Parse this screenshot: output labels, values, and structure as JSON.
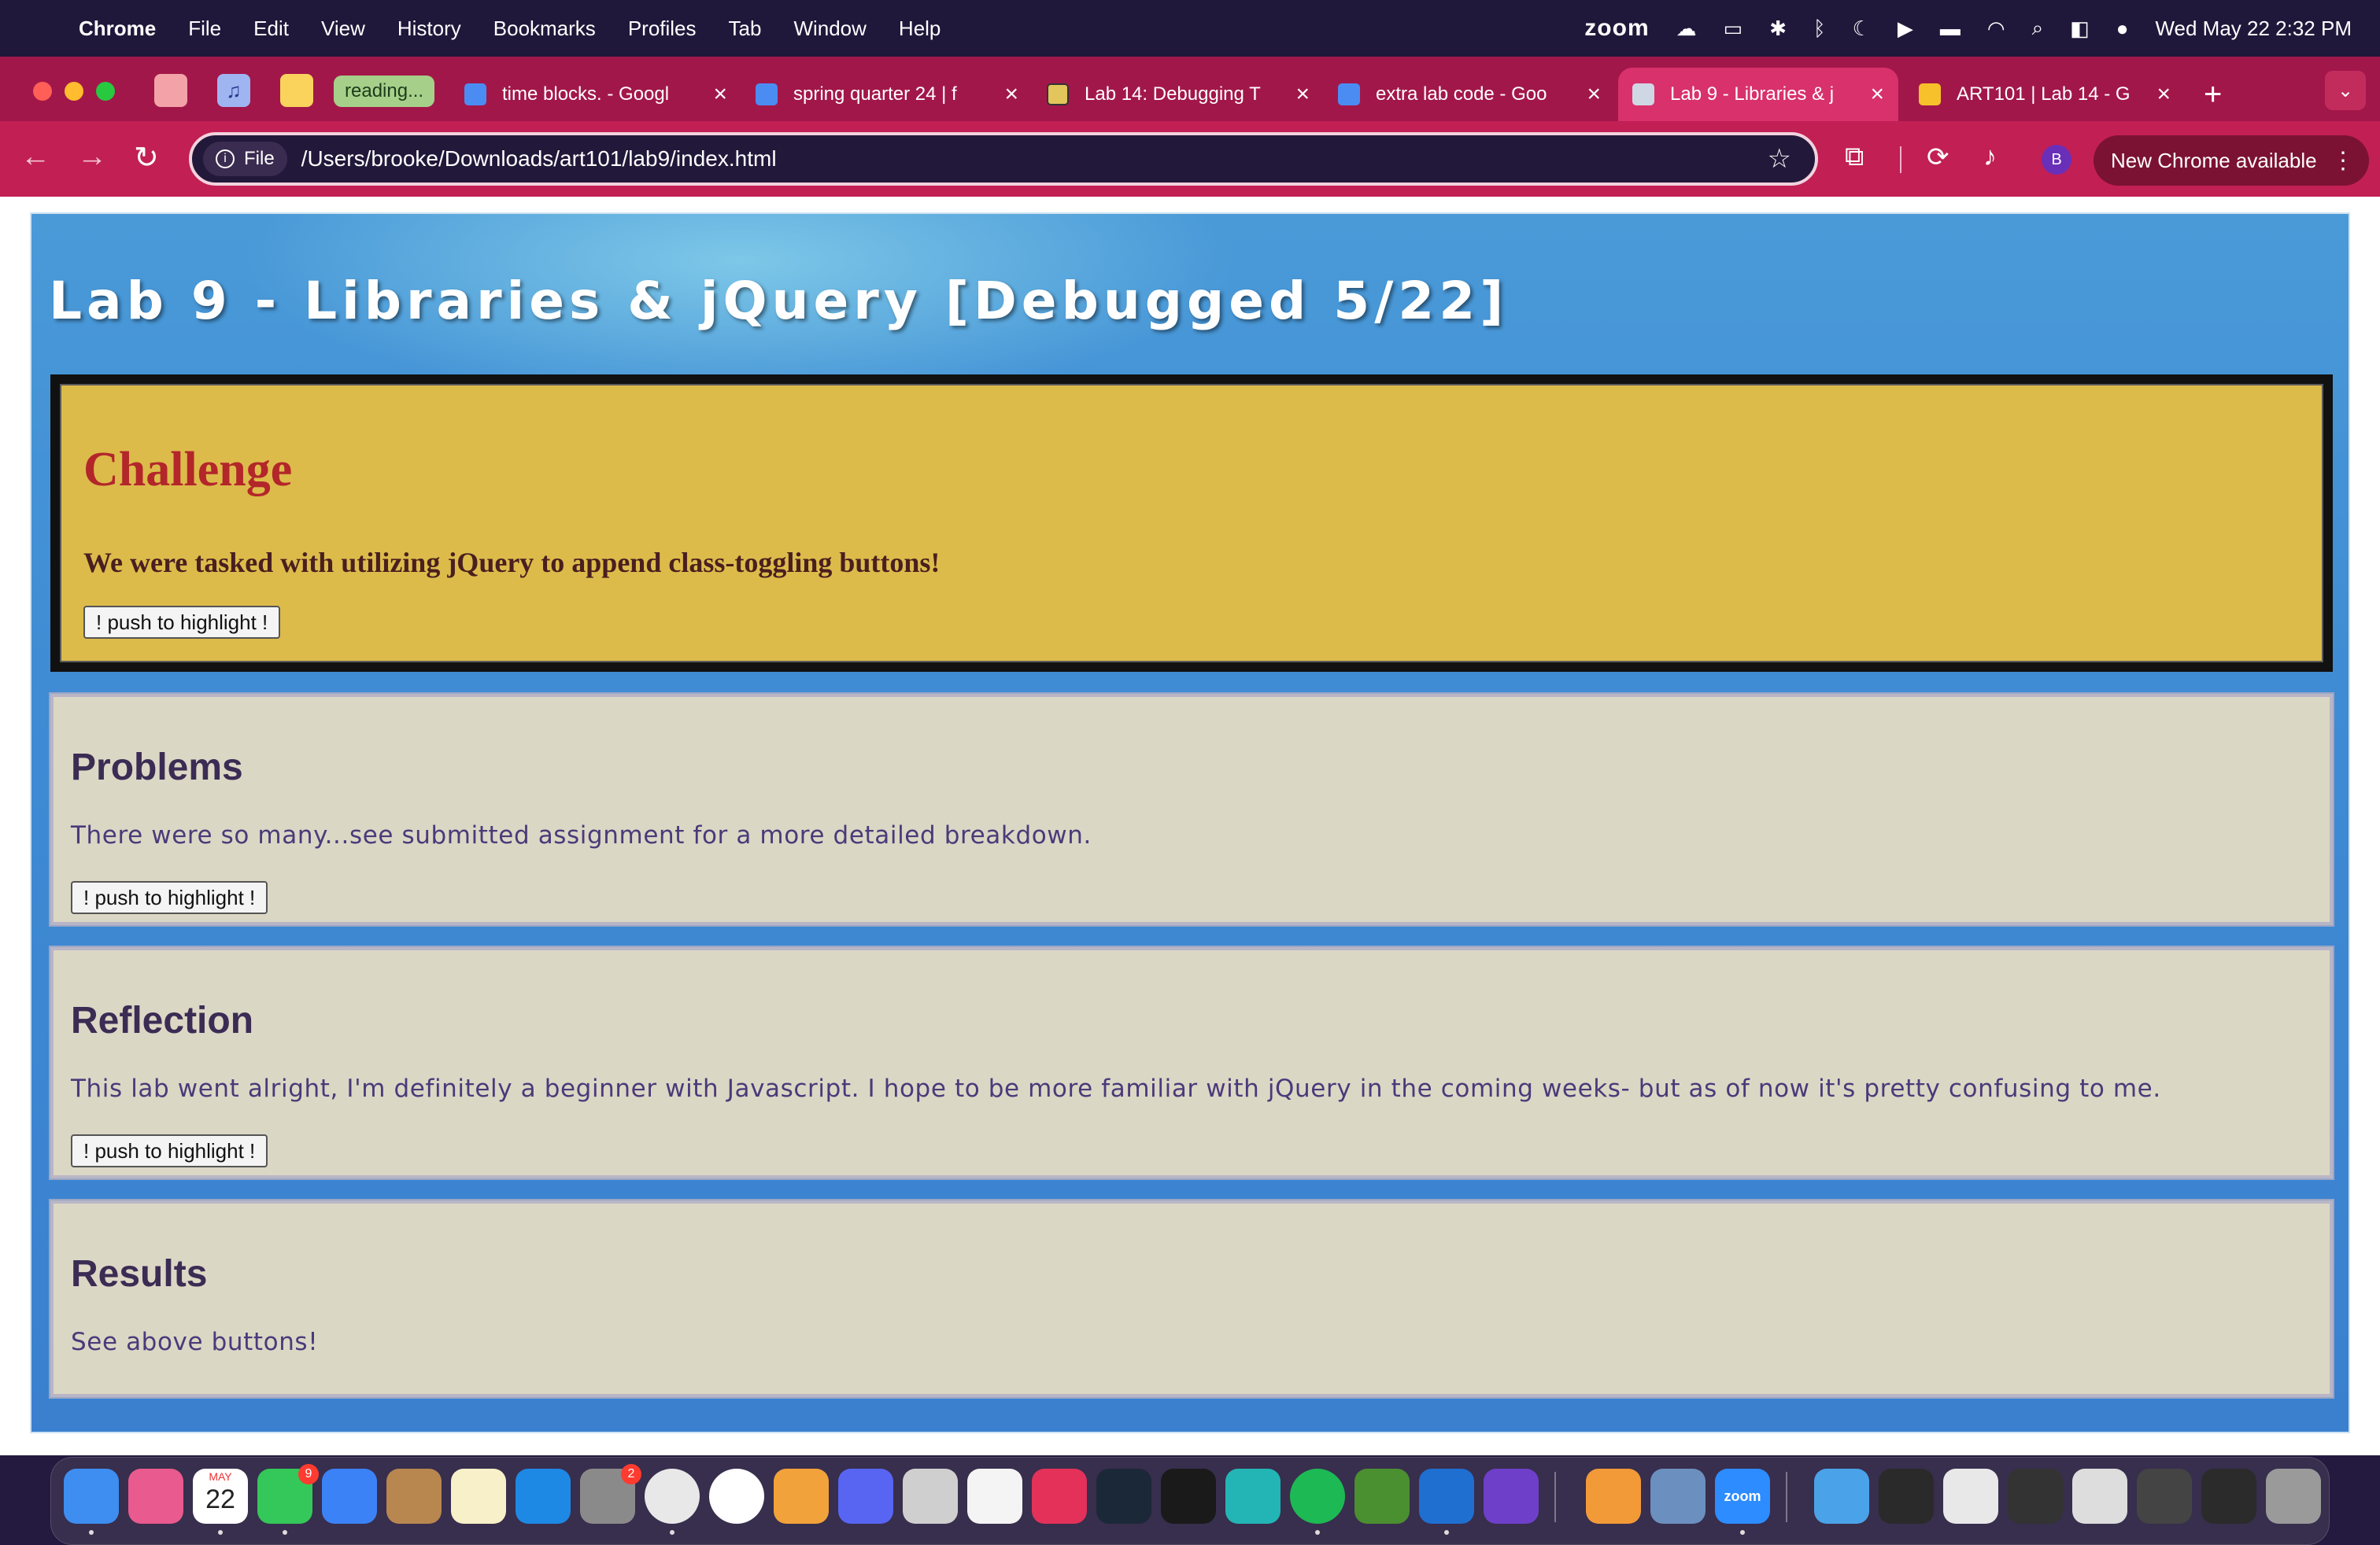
{
  "menubar": {
    "app_name": "Chrome",
    "items": [
      "File",
      "Edit",
      "View",
      "History",
      "Bookmarks",
      "Profiles",
      "Tab",
      "Window",
      "Help"
    ],
    "zoom_label": "zoom",
    "clock": "Wed May 22  2:32 PM"
  },
  "tabs": {
    "group_chip": "reading...",
    "items": [
      {
        "title": "time blocks. - Googl",
        "icon": "docs-icon"
      },
      {
        "title": "spring quarter 24 | f",
        "icon": "docs-icon"
      },
      {
        "title": "Lab 14: Debugging T",
        "icon": "lab-icon"
      },
      {
        "title": "extra lab code - Goo",
        "icon": "docs-icon"
      },
      {
        "title": "Lab 9 - Libraries & j",
        "icon": "globe-icon",
        "active": true
      },
      {
        "title": "ART101 | Lab 14 - G",
        "icon": "slides-icon"
      }
    ],
    "new_tab": "+",
    "menu": "⌄"
  },
  "toolbar": {
    "file_chip": "File",
    "url": "/Users/brooke/Downloads/art101/lab9/index.html",
    "avatar_initial": "B",
    "update_label": "New Chrome available"
  },
  "page": {
    "title": "Lab 9 - Libraries & jQuery [Debugged 5/22]",
    "challenge": {
      "heading": "Challenge",
      "text": "We were tasked with utilizing jQuery to append class-toggling buttons!",
      "button": "! push to highlight !"
    },
    "problems": {
      "heading": "Problems",
      "text": "There were so many...see submitted assignment for a more detailed breakdown.",
      "button": "! push to highlight !"
    },
    "reflection": {
      "heading": "Reflection",
      "text": "This lab went alright, I'm definitely a beginner with Javascript. I hope to be more familiar with jQuery in the coming weeks- but as of now it's pretty confusing to me.",
      "button": "! push to highlight !"
    },
    "results": {
      "heading": "Results",
      "text": "See above buttons!"
    }
  },
  "dock": {
    "calendar_month": "MAY",
    "calendar_day": "22",
    "messages_badge": "9",
    "settings_badge": "2",
    "zoom_label": "zoom"
  },
  "colors": {
    "tab_strip": "#a2174a",
    "toolbar": "#c21f55",
    "challenge_bg": "#dcbb4b",
    "card_bg": "#dbd7c5",
    "page_blue": "#3f8bd4"
  }
}
